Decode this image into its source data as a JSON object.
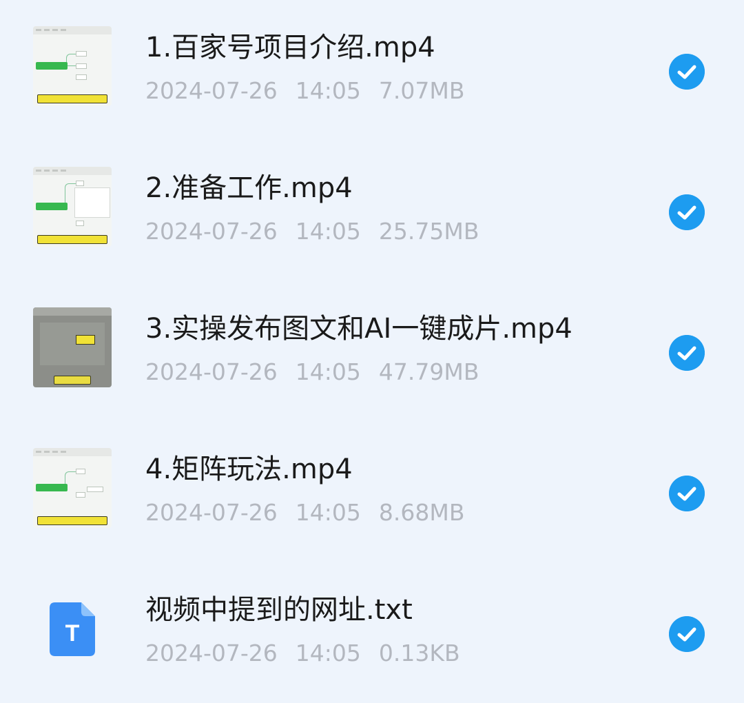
{
  "files": [
    {
      "name": "1.百家号项目介绍.mp4",
      "date": "2024-07-26",
      "time": "14:05",
      "size": "7.07MB",
      "type": "video",
      "selected": true
    },
    {
      "name": "2.准备工作.mp4",
      "date": "2024-07-26",
      "time": "14:05",
      "size": "25.75MB",
      "type": "video",
      "selected": true
    },
    {
      "name": "3.实操发布图文和AI一键成片.mp4",
      "date": "2024-07-26",
      "time": "14:05",
      "size": "47.79MB",
      "type": "video",
      "selected": true
    },
    {
      "name": "4.矩阵玩法.mp4",
      "date": "2024-07-26",
      "time": "14:05",
      "size": "8.68MB",
      "type": "video",
      "selected": true
    },
    {
      "name": "视频中提到的网址.txt",
      "date": "2024-07-26",
      "time": "14:05",
      "size": "0.13KB",
      "type": "text",
      "selected": true
    }
  ],
  "icons": {
    "text_file_letter": "T",
    "check": "checkmark-icon"
  },
  "colors": {
    "background": "#eef4fc",
    "check_blue": "#1d9cf0",
    "text_icon_blue": "#3b8ff5",
    "meta_gray": "#b3b7bf",
    "name_text": "#1a1a1a"
  }
}
